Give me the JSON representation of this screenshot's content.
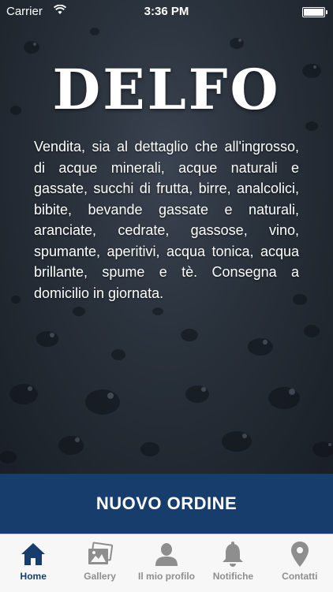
{
  "status_bar": {
    "carrier": "Carrier",
    "time": "3:36 PM"
  },
  "header": {
    "logo_text": "DELFO"
  },
  "main": {
    "description": "Vendita, sia al dettaglio che all'ingrosso, di acque minerali, acque naturali e gassate, succhi di frutta, birre, analcolici, bibite, bevande gassate e naturali, aranciate, cedrate, gassose, vino, spumante, aperitivi, acqua tonica, acqua brillante, spume e tè. Consegna a domicilio in giornata."
  },
  "order_button": {
    "label": "NUOVO ORDINE"
  },
  "tab_bar": {
    "tabs": [
      {
        "label": "Home",
        "icon": "home-icon",
        "active": true
      },
      {
        "label": "Gallery",
        "icon": "gallery-icon",
        "active": false
      },
      {
        "label": "Il mio profilo",
        "icon": "profile-icon",
        "active": false
      },
      {
        "label": "Notifiche",
        "icon": "bell-icon",
        "active": false
      },
      {
        "label": "Contatti",
        "icon": "location-pin-icon",
        "active": false
      }
    ]
  },
  "colors": {
    "accent": "#173d6d",
    "tab_inactive": "#8e8e8e",
    "tab_bar_bg": "#f7f7f7"
  }
}
